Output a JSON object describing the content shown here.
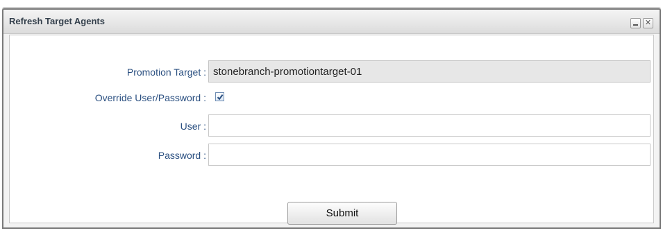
{
  "dialog": {
    "title": "Refresh Target Agents",
    "minimize_glyph": "",
    "close_glyph": "✕"
  },
  "form": {
    "promotion_target": {
      "label": "Promotion Target",
      "value": "stonebranch-promotiontarget-01"
    },
    "override": {
      "label": "Override User/Password",
      "checked": true
    },
    "user": {
      "label": "User",
      "value": ""
    },
    "password": {
      "label": "Password",
      "value": ""
    },
    "colon": ":"
  },
  "actions": {
    "submit_label": "Submit"
  },
  "colors": {
    "label": "#2a4f80",
    "readonly_bg": "#e7e7e7",
    "checkmark": "#2a4f80"
  }
}
